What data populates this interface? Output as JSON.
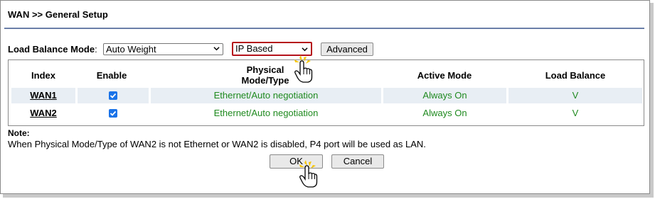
{
  "header": {
    "title": "WAN >> General Setup"
  },
  "load_balance": {
    "label": "Load Balance Mode",
    "colon": ":",
    "mode_value": "Auto Weight",
    "type_value": "IP Based",
    "advanced_label": "Advanced"
  },
  "table": {
    "headers": {
      "index": "Index",
      "enable": "Enable",
      "physical_1": "Physical",
      "physical_2": "Mode/Type",
      "active": "Active Mode",
      "load": "Load Balance"
    },
    "rows": [
      {
        "index": "WAN1",
        "enabled": true,
        "physical": "Ethernet/Auto negotiation",
        "active": "Always On",
        "load": "V"
      },
      {
        "index": "WAN2",
        "enabled": true,
        "physical": "Ethernet/Auto negotiation",
        "active": "Always On",
        "load": "V"
      }
    ]
  },
  "note": {
    "heading": "Note:",
    "text": "When Physical Mode/Type of WAN2 is not Ethernet or WAN2 is disabled, P4 port will be used as LAN."
  },
  "actions": {
    "ok_label": "OK",
    "cancel_label": "Cancel"
  },
  "colors": {
    "accent_red": "#b5121b",
    "status_green": "#1f8a1f",
    "row_bg": "#e8eef4",
    "checkbox_blue": "#1a73e8"
  },
  "icons": [
    "chevron-down-icon",
    "checkbox-checked-icon",
    "hand-cursor-icon"
  ]
}
